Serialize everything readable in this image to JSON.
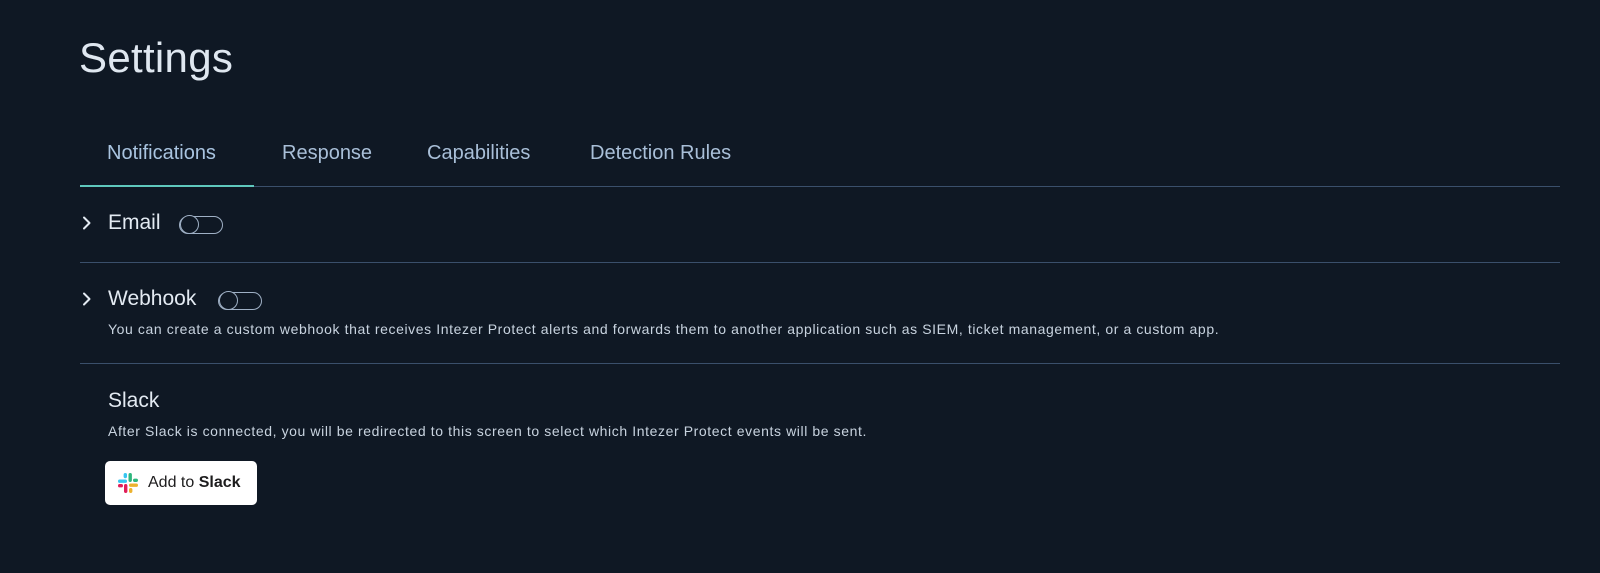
{
  "page": {
    "title": "Settings"
  },
  "tabs": [
    {
      "label": "Notifications",
      "active": true
    },
    {
      "label": "Response",
      "active": false
    },
    {
      "label": "Capabilities",
      "active": false
    },
    {
      "label": "Detection Rules",
      "active": false
    }
  ],
  "sections": {
    "email": {
      "label": "Email",
      "enabled": false
    },
    "webhook": {
      "label": "Webhook",
      "enabled": false,
      "description": "You can create a custom webhook that receives Intezer Protect alerts and forwards them to another application such as SIEM, ticket management, or a custom app."
    },
    "slack": {
      "label": "Slack",
      "description": "After Slack is connected, you will be redirected to this screen to select which Intezer Protect events will be sent.",
      "button_prefix": "Add to",
      "button_brand": "Slack"
    }
  },
  "colors": {
    "background": "#0f1824",
    "tab_indicator": "#5fc8bd",
    "divider": "#3a4f6b",
    "tab_text": "#a9bfd8",
    "slack_blue": "#36c5f0",
    "slack_green": "#2eb67d",
    "slack_yellow": "#ecb22e",
    "slack_red": "#e01e5a"
  },
  "icons": {
    "expand": "chevron-right-icon",
    "slack": "slack-logo-icon"
  }
}
